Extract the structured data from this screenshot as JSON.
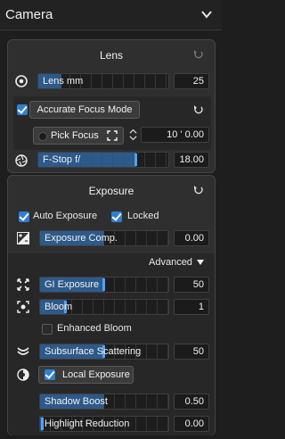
{
  "header": {
    "title": "Camera"
  },
  "lens": {
    "title": "Lens",
    "lens_mm": {
      "label": "Lens mm",
      "value": "25",
      "fill": 0.18
    },
    "focus_mode_label": "Accurate Focus Mode",
    "pick_focus_label": "Pick Focus",
    "focus_distance": "10 ' 0.00",
    "fstop": {
      "label": "F-Stop f/",
      "value": "18.00",
      "fill": 0.75
    }
  },
  "exposure": {
    "title": "Exposure",
    "auto_exposure": {
      "label": "Auto Exposure",
      "checked": true
    },
    "locked": {
      "label": "Locked",
      "checked": true
    },
    "exposure_comp": {
      "label": "Exposure Comp.",
      "value": "0.00",
      "fill": 0.5
    },
    "advanced_label": "Advanced",
    "gi_exposure": {
      "label": "GI Exposure",
      "value": "50",
      "fill": 0.5
    },
    "bloom": {
      "label": "Bloom",
      "value": "1",
      "fill": 0.2
    },
    "enhanced_bloom": {
      "label": "Enhanced Bloom",
      "checked": false
    },
    "subsurface": {
      "label": "Subsurface Scattering",
      "value": "50",
      "fill": 0.5
    },
    "local_exposure_label": "Local Exposure",
    "shadow_boost": {
      "label": "Shadow Boost",
      "value": "0.50",
      "fill": 0.5
    },
    "highlight_reduction": {
      "label": "Highlight Reduction",
      "value": "0.00",
      "fill": 0.02
    }
  },
  "colors": {
    "accent": "#2f7fd3",
    "slider_fill": "#2c5a8c",
    "handle": "#4da3ff",
    "panel": "#2f2f2f"
  }
}
